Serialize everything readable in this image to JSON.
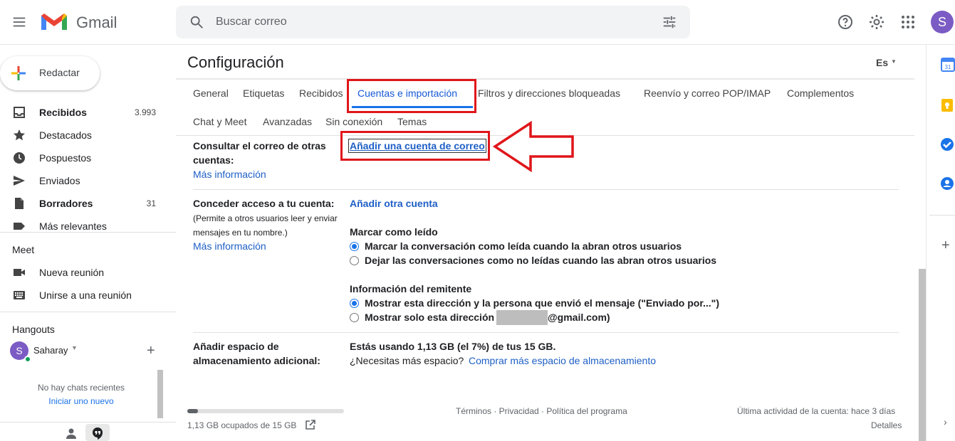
{
  "app": {
    "name": "Gmail",
    "avatar_letter": "S"
  },
  "search": {
    "placeholder": "Buscar correo"
  },
  "compose": {
    "label": "Redactar"
  },
  "nav": [
    {
      "label": "Recibidos",
      "count": "3.993",
      "bold": true,
      "icon": "inbox-icon"
    },
    {
      "label": "Destacados",
      "count": "",
      "bold": false,
      "icon": "star-icon"
    },
    {
      "label": "Pospuestos",
      "count": "",
      "bold": false,
      "icon": "clock-icon"
    },
    {
      "label": "Enviados",
      "count": "",
      "bold": false,
      "icon": "send-icon"
    },
    {
      "label": "Borradores",
      "count": "31",
      "bold": true,
      "icon": "draft-icon"
    },
    {
      "label": "Más relevantes",
      "count": "",
      "bold": false,
      "icon": "label-icon"
    }
  ],
  "meet": {
    "title": "Meet",
    "new_meeting": "Nueva reunión",
    "join_meeting": "Unirse a una reunión"
  },
  "hangouts": {
    "title": "Hangouts",
    "user": "Saharay",
    "user_letter": "S",
    "no_chats": "No hay chats recientes",
    "start_new": "Iniciar uno nuevo"
  },
  "settings": {
    "title": "Configuración",
    "lang": "Es",
    "tabs": [
      "General",
      "Etiquetas",
      "Recibidos",
      "Cuentas e importación",
      "Filtros y direcciones bloqueadas",
      "Reenvío y correo POP/IMAP",
      "Complementos",
      "Chat y Meet",
      "Avanzadas",
      "Sin conexión",
      "Temas"
    ],
    "check_mail": {
      "label": "Consultar el correo de otras cuentas:",
      "more_info": "Más información",
      "add_account": "Añadir una cuenta de correo"
    },
    "grant_access": {
      "label": "Conceder acceso a tu cuenta:",
      "desc": "(Permite a otros usuarios leer y enviar mensajes en tu nombre.)",
      "more_info": "Más información",
      "add_other": "Añadir otra cuenta",
      "mark_read_title": "Marcar como leído",
      "mark_read_opt1": "Marcar la conversación como leída cuando la abran otros usuarios",
      "mark_read_opt2": "Dejar las conversaciones como no leídas cuando las abran otros usuarios",
      "sender_info_title": "Información del remitente",
      "sender_opt1": "Mostrar esta dirección y la persona que envió el mensaje (\"Enviado por...\")",
      "sender_opt2_prefix": "Mostrar solo esta dirección (",
      "sender_opt2_suffix": "@gmail.com)"
    },
    "storage": {
      "label": "Añadir espacio de almacenamiento adicional:",
      "usage": "Estás usando 1,13 GB (el 7%) de tus 15 GB.",
      "need_more": "¿Necesitas más espacio?",
      "buy_link": "Comprar más espacio de almacenamiento"
    }
  },
  "footer": {
    "storage_text": "1,13 GB ocupados de 15 GB",
    "storage_fraction": 0.07,
    "links": "Términos · Privacidad · Política del programa",
    "last_activity": "Última actividad de la cuenta: hace 3 días",
    "details": "Detalles"
  },
  "colors": {
    "accent": "#1a73e8",
    "highlight_red": "#e0161b",
    "avatar": "#7b5bc4"
  }
}
